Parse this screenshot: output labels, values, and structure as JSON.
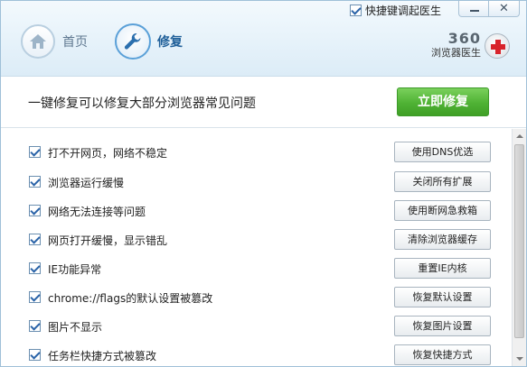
{
  "header": {
    "shortcut_label": "快捷键调起医生",
    "shortcut_checked": true,
    "nav": [
      {
        "label": "首页",
        "icon": "home-icon",
        "active": false
      },
      {
        "label": "修复",
        "icon": "wrench-icon",
        "active": true
      }
    ],
    "brand_number": "360",
    "brand_name": "浏览器医生"
  },
  "subbar": {
    "text": "一键修复可以修复大部分浏览器常见问题",
    "button_label": "立即修复",
    "button_color": "#4fb234"
  },
  "items": [
    {
      "label": "打不开网页，网络不稳定",
      "action": "使用DNS优选",
      "checked": true
    },
    {
      "label": "浏览器运行缓慢",
      "action": "关闭所有扩展",
      "checked": true
    },
    {
      "label": "网络无法连接等问题",
      "action": "使用断网急救箱",
      "checked": true
    },
    {
      "label": "网页打开缓慢，显示错乱",
      "action": "清除浏览器缓存",
      "checked": true
    },
    {
      "label": "IE功能异常",
      "action": "重置IE内核",
      "checked": true
    },
    {
      "label": "chrome://flags的默认设置被篡改",
      "action": "恢复默认设置",
      "checked": true
    },
    {
      "label": "图片不显示",
      "action": "恢复图片设置",
      "checked": true
    },
    {
      "label": "任务栏快捷方式被篡改",
      "action": "恢复快捷方式",
      "checked": true
    }
  ]
}
